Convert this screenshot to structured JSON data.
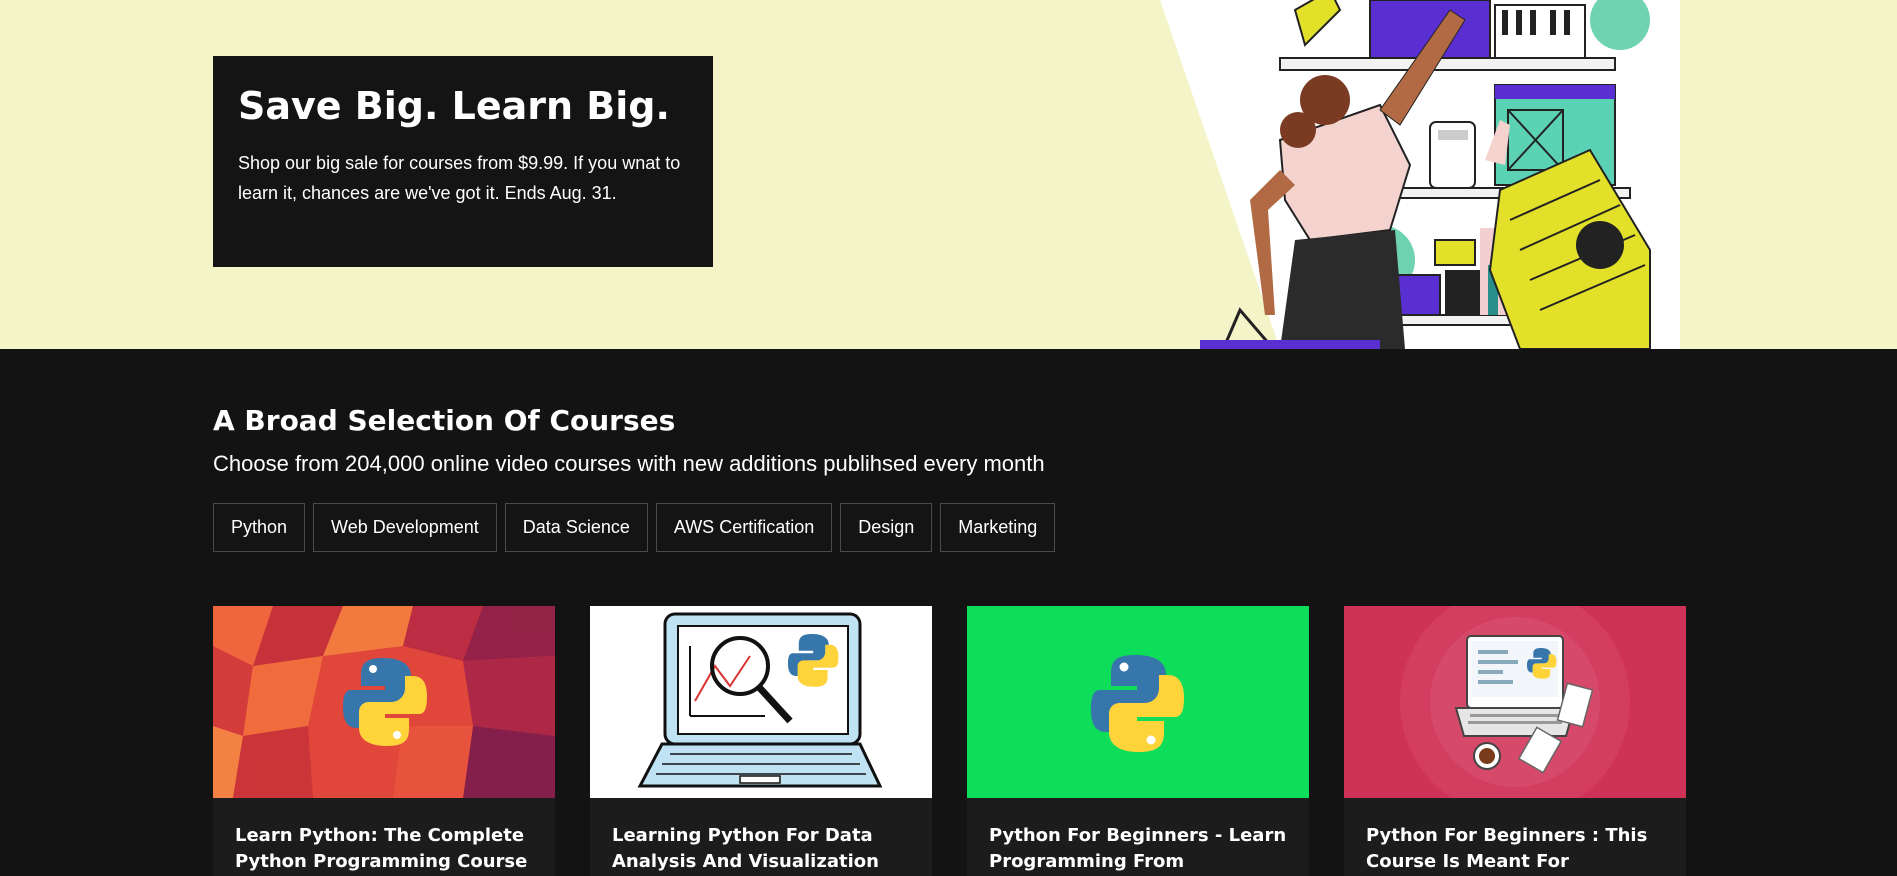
{
  "hero": {
    "title": "Save Big. Learn Big.",
    "text": "Shop our big sale for courses from $9.99. If you wnat to learn it, chances are we've got it. Ends Aug. 31."
  },
  "section": {
    "title": "A Broad Selection Of Courses",
    "subtitle": "Choose from 204,000 online video courses with new additions publihsed every month"
  },
  "tabs": [
    "Python",
    "Web Development",
    "Data Science",
    "AWS Certification",
    "Design",
    "Marketing"
  ],
  "courses": [
    {
      "title": "Learn Python: The Complete Python Programming Course",
      "thumb": "python-logo-red-mosaic"
    },
    {
      "title": "Learning Python For Data Analysis And Visualization",
      "thumb": "laptop-chart-python"
    },
    {
      "title": "Python For Beginners - Learn Programming From",
      "thumb": "python-logo-green"
    },
    {
      "title": "Python For Beginners : This Course Is Meant For",
      "thumb": "laptop-python-pink"
    }
  ],
  "colors": {
    "hero_bg": "#f3f4c8",
    "page_bg": "#131313",
    "card_bg": "#1c1c1c",
    "accent_green": "#0ddd59",
    "accent_pink": "#cf3257"
  }
}
